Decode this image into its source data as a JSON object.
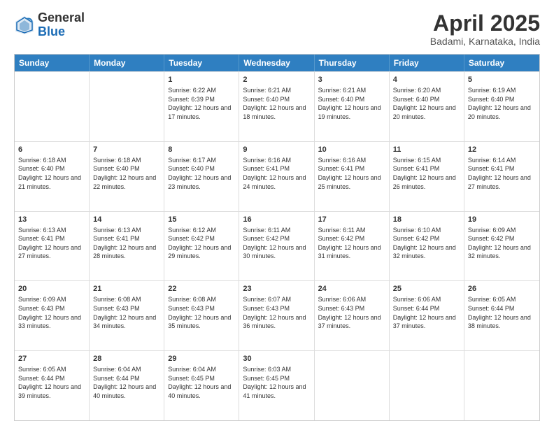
{
  "header": {
    "logo_general": "General",
    "logo_blue": "Blue",
    "month_title": "April 2025",
    "location": "Badami, Karnataka, India"
  },
  "weekdays": [
    "Sunday",
    "Monday",
    "Tuesday",
    "Wednesday",
    "Thursday",
    "Friday",
    "Saturday"
  ],
  "rows": [
    [
      {
        "day": "",
        "info": ""
      },
      {
        "day": "",
        "info": ""
      },
      {
        "day": "1",
        "info": "Sunrise: 6:22 AM\nSunset: 6:39 PM\nDaylight: 12 hours and 17 minutes."
      },
      {
        "day": "2",
        "info": "Sunrise: 6:21 AM\nSunset: 6:40 PM\nDaylight: 12 hours and 18 minutes."
      },
      {
        "day": "3",
        "info": "Sunrise: 6:21 AM\nSunset: 6:40 PM\nDaylight: 12 hours and 19 minutes."
      },
      {
        "day": "4",
        "info": "Sunrise: 6:20 AM\nSunset: 6:40 PM\nDaylight: 12 hours and 20 minutes."
      },
      {
        "day": "5",
        "info": "Sunrise: 6:19 AM\nSunset: 6:40 PM\nDaylight: 12 hours and 20 minutes."
      }
    ],
    [
      {
        "day": "6",
        "info": "Sunrise: 6:18 AM\nSunset: 6:40 PM\nDaylight: 12 hours and 21 minutes."
      },
      {
        "day": "7",
        "info": "Sunrise: 6:18 AM\nSunset: 6:40 PM\nDaylight: 12 hours and 22 minutes."
      },
      {
        "day": "8",
        "info": "Sunrise: 6:17 AM\nSunset: 6:40 PM\nDaylight: 12 hours and 23 minutes."
      },
      {
        "day": "9",
        "info": "Sunrise: 6:16 AM\nSunset: 6:41 PM\nDaylight: 12 hours and 24 minutes."
      },
      {
        "day": "10",
        "info": "Sunrise: 6:16 AM\nSunset: 6:41 PM\nDaylight: 12 hours and 25 minutes."
      },
      {
        "day": "11",
        "info": "Sunrise: 6:15 AM\nSunset: 6:41 PM\nDaylight: 12 hours and 26 minutes."
      },
      {
        "day": "12",
        "info": "Sunrise: 6:14 AM\nSunset: 6:41 PM\nDaylight: 12 hours and 27 minutes."
      }
    ],
    [
      {
        "day": "13",
        "info": "Sunrise: 6:13 AM\nSunset: 6:41 PM\nDaylight: 12 hours and 27 minutes."
      },
      {
        "day": "14",
        "info": "Sunrise: 6:13 AM\nSunset: 6:41 PM\nDaylight: 12 hours and 28 minutes."
      },
      {
        "day": "15",
        "info": "Sunrise: 6:12 AM\nSunset: 6:42 PM\nDaylight: 12 hours and 29 minutes."
      },
      {
        "day": "16",
        "info": "Sunrise: 6:11 AM\nSunset: 6:42 PM\nDaylight: 12 hours and 30 minutes."
      },
      {
        "day": "17",
        "info": "Sunrise: 6:11 AM\nSunset: 6:42 PM\nDaylight: 12 hours and 31 minutes."
      },
      {
        "day": "18",
        "info": "Sunrise: 6:10 AM\nSunset: 6:42 PM\nDaylight: 12 hours and 32 minutes."
      },
      {
        "day": "19",
        "info": "Sunrise: 6:09 AM\nSunset: 6:42 PM\nDaylight: 12 hours and 32 minutes."
      }
    ],
    [
      {
        "day": "20",
        "info": "Sunrise: 6:09 AM\nSunset: 6:43 PM\nDaylight: 12 hours and 33 minutes."
      },
      {
        "day": "21",
        "info": "Sunrise: 6:08 AM\nSunset: 6:43 PM\nDaylight: 12 hours and 34 minutes."
      },
      {
        "day": "22",
        "info": "Sunrise: 6:08 AM\nSunset: 6:43 PM\nDaylight: 12 hours and 35 minutes."
      },
      {
        "day": "23",
        "info": "Sunrise: 6:07 AM\nSunset: 6:43 PM\nDaylight: 12 hours and 36 minutes."
      },
      {
        "day": "24",
        "info": "Sunrise: 6:06 AM\nSunset: 6:43 PM\nDaylight: 12 hours and 37 minutes."
      },
      {
        "day": "25",
        "info": "Sunrise: 6:06 AM\nSunset: 6:44 PM\nDaylight: 12 hours and 37 minutes."
      },
      {
        "day": "26",
        "info": "Sunrise: 6:05 AM\nSunset: 6:44 PM\nDaylight: 12 hours and 38 minutes."
      }
    ],
    [
      {
        "day": "27",
        "info": "Sunrise: 6:05 AM\nSunset: 6:44 PM\nDaylight: 12 hours and 39 minutes."
      },
      {
        "day": "28",
        "info": "Sunrise: 6:04 AM\nSunset: 6:44 PM\nDaylight: 12 hours and 40 minutes."
      },
      {
        "day": "29",
        "info": "Sunrise: 6:04 AM\nSunset: 6:45 PM\nDaylight: 12 hours and 40 minutes."
      },
      {
        "day": "30",
        "info": "Sunrise: 6:03 AM\nSunset: 6:45 PM\nDaylight: 12 hours and 41 minutes."
      },
      {
        "day": "",
        "info": ""
      },
      {
        "day": "",
        "info": ""
      },
      {
        "day": "",
        "info": ""
      }
    ]
  ]
}
